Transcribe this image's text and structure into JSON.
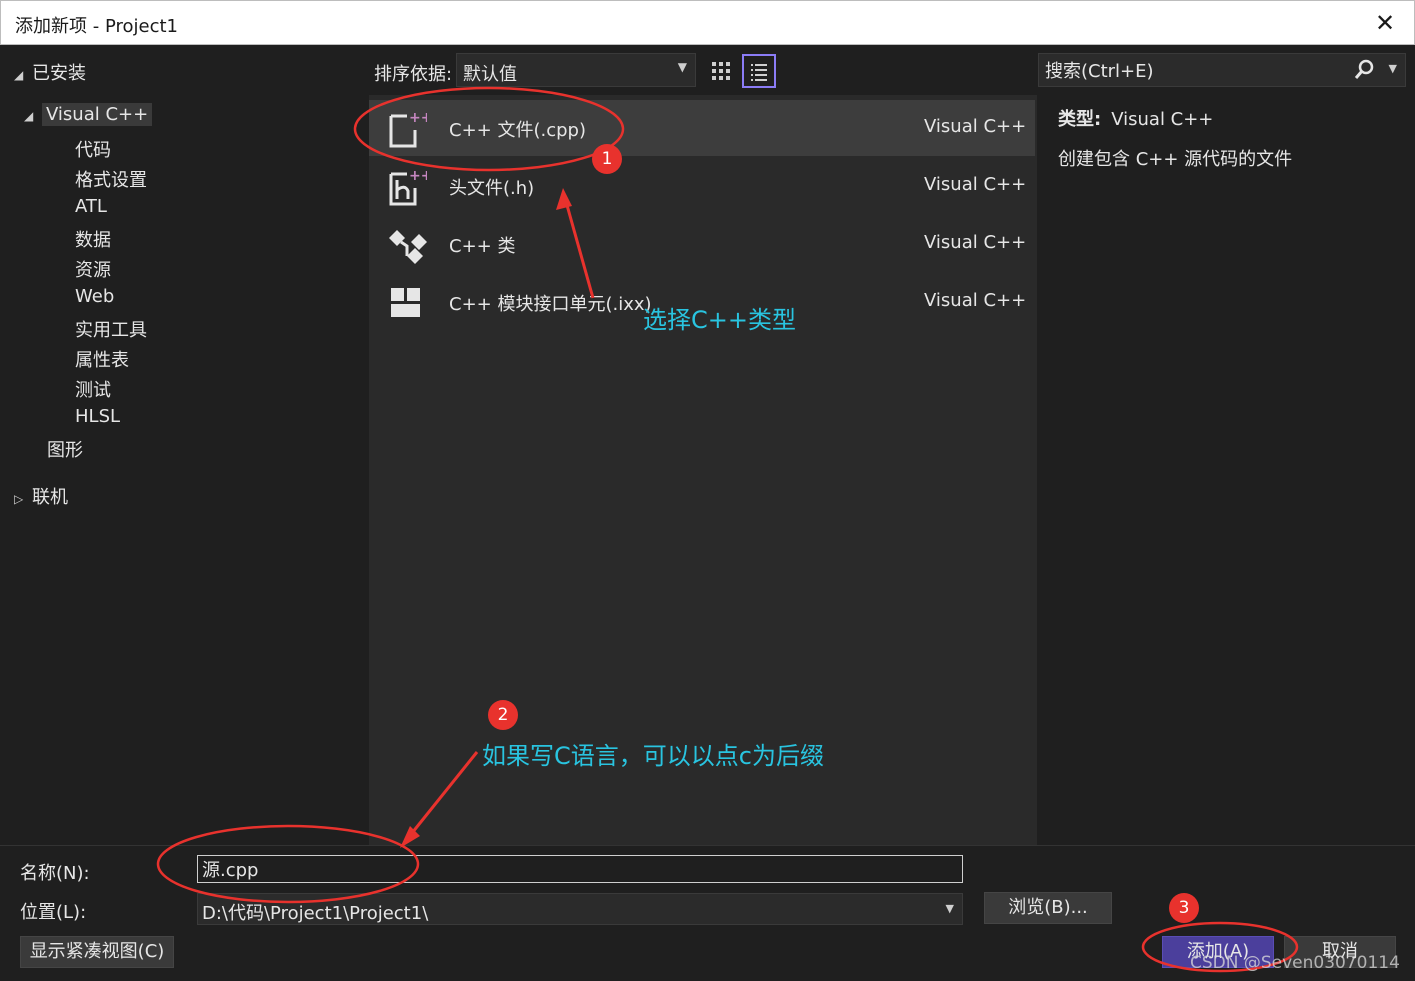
{
  "window": {
    "title": "添加新项 - Project1",
    "close_glyph": "✕"
  },
  "tree": {
    "installed": "已安装",
    "visual_cpp": "Visual C++",
    "children": [
      "代码",
      "格式设置",
      "ATL",
      "数据",
      "资源",
      "Web",
      "实用工具",
      "属性表",
      "测试",
      "HLSL"
    ],
    "graphics": "图形",
    "online": "联机"
  },
  "toolbar": {
    "sort_label": "排序依据:",
    "sort_value": "默认值",
    "search_placeholder": "搜索(Ctrl+E)"
  },
  "templates": [
    {
      "name": "C++ 文件(.cpp)",
      "lang": "Visual C++",
      "icon": "cpp-file-icon",
      "selected": true
    },
    {
      "name": "头文件(.h)",
      "lang": "Visual C++",
      "icon": "header-file-icon",
      "selected": false
    },
    {
      "name": "C++ 类",
      "lang": "Visual C++",
      "icon": "cpp-class-icon",
      "selected": false
    },
    {
      "name": "C++ 模块接口单元(.ixx)",
      "lang": "Visual C++",
      "icon": "module-unit-icon",
      "selected": false
    }
  ],
  "details": {
    "type_label": "类型:",
    "type_value": "Visual C++",
    "description": "创建包含 C++ 源代码的文件"
  },
  "form": {
    "name_label": "名称(N):",
    "name_value": "源.cpp",
    "location_label": "位置(L):",
    "location_value": "D:\\代码\\Project1\\Project1\\",
    "browse_label": "浏览(B)...",
    "compact_view_label": "显示紧凑视图(C)",
    "add_label": "添加(A)",
    "cancel_label": "取消"
  },
  "annotations": {
    "badge1": "1",
    "badge2": "2",
    "badge3": "3",
    "note1": "选择C++类型",
    "note2": "如果写C语言，可以以点c为后缀",
    "accent": "#e8322d",
    "note_color": "#29c4e0"
  },
  "watermark": "CSDN @Seven03070114"
}
